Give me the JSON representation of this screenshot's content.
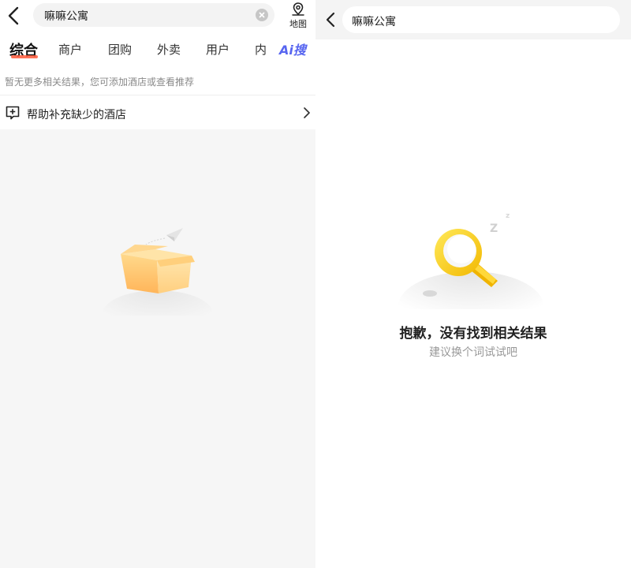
{
  "left_panel": {
    "search": {
      "query": "嘛嘛公寓"
    },
    "map": {
      "label": "地图"
    },
    "tabs": [
      {
        "label": "综合",
        "active": true
      },
      {
        "label": "商户"
      },
      {
        "label": "团购"
      },
      {
        "label": "外卖"
      },
      {
        "label": "用户"
      },
      {
        "label": "内"
      }
    ],
    "ai_tab": {
      "label": "Ai搜"
    },
    "notice": "暂无更多相关结果，您可添加酒店或查看推荐",
    "help_row": {
      "label": "帮助补充缺少的酒店"
    },
    "icons": [
      "back-arrow-icon",
      "clear-icon",
      "map-pin-icon",
      "add-note-icon",
      "chevron-right-icon",
      "empty-box-illustration"
    ],
    "colors": {
      "accent_underline": "#ff5a3c",
      "ai_tab": "#5866f0"
    }
  },
  "right_panel": {
    "search": {
      "query": "嘛嘛公寓"
    },
    "empty_state": {
      "title": "抱歉，没有找到相关结果",
      "subtitle": "建议换个词试试吧"
    },
    "icons": [
      "back-arrow-icon",
      "magnifier-sleeping-illustration"
    ]
  }
}
